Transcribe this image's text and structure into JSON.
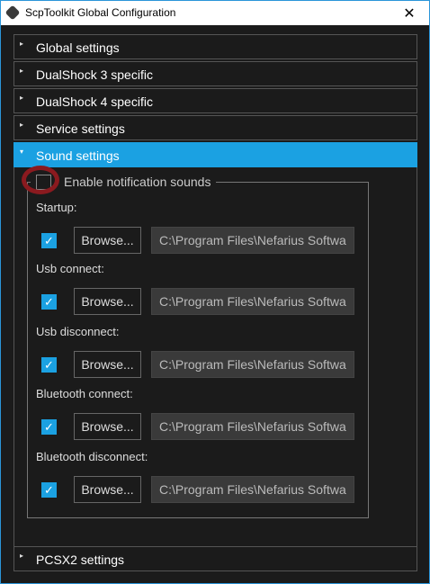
{
  "window": {
    "title": "ScpToolkit Global Configuration",
    "close_glyph": "✕",
    "app_icon": "scptoolkit-icon"
  },
  "panels": [
    {
      "label": "Global settings",
      "expanded": false
    },
    {
      "label": "DualShock 3 specific",
      "expanded": false
    },
    {
      "label": "DualShock 4 specific",
      "expanded": false
    },
    {
      "label": "Service settings",
      "expanded": false
    },
    {
      "label": "Sound settings",
      "expanded": true
    },
    {
      "label": "PCSX2 settings",
      "expanded": false
    }
  ],
  "collapsed_arrow": "▸",
  "expanded_arrow": "▾",
  "sound": {
    "enable_label": "Enable notification sounds",
    "enable_checked": false,
    "check_glyph": "✓",
    "browse_label": "Browse...",
    "items": [
      {
        "label": "Startup:",
        "checked": true,
        "path": "C:\\Program Files\\Nefarius Softwa"
      },
      {
        "label": "Usb connect:",
        "checked": true,
        "path": "C:\\Program Files\\Nefarius Softwa"
      },
      {
        "label": "Usb disconnect:",
        "checked": true,
        "path": "C:\\Program Files\\Nefarius Softwa"
      },
      {
        "label": "Bluetooth connect:",
        "checked": true,
        "path": "C:\\Program Files\\Nefarius Softwa"
      },
      {
        "label": "Bluetooth disconnect:",
        "checked": true,
        "path": "C:\\Program Files\\Nefarius Softwa"
      }
    ]
  },
  "colors": {
    "accent": "#1ba1e2",
    "background": "#1b1b1b",
    "highlight_ring": "#8b1a1f"
  }
}
